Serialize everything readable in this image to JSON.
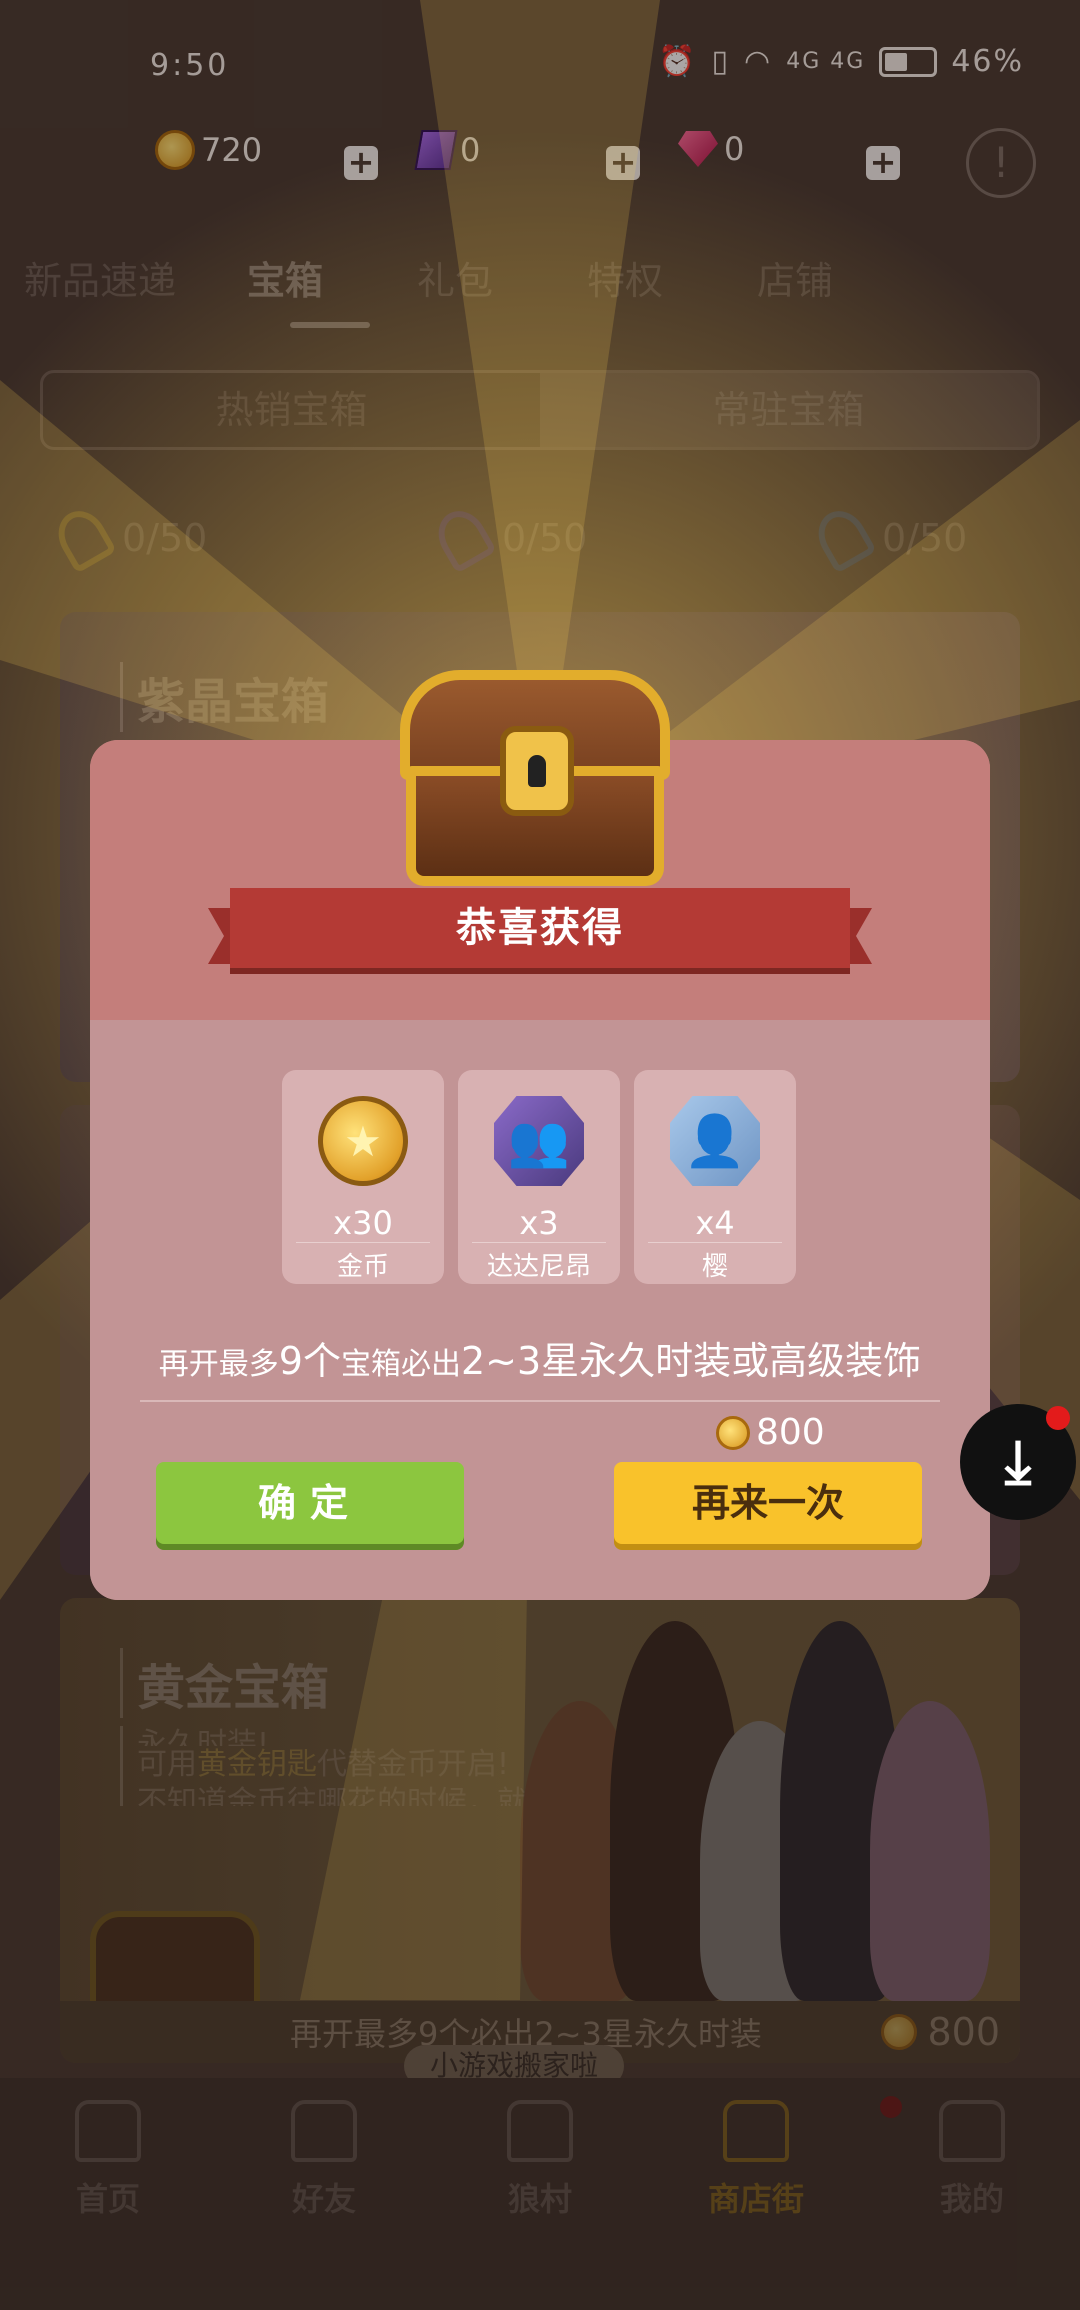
{
  "status_bar": {
    "time": "9:50",
    "network": "4G 4G",
    "battery": "46%"
  },
  "currency": {
    "coins": "720",
    "purple_tickets": "0",
    "gems": "0",
    "plus": "+"
  },
  "alert": "!",
  "top_tabs": [
    "新品速递",
    "宝箱",
    "礼包",
    "特权",
    "店铺"
  ],
  "sub_tabs": [
    "热销宝箱",
    "常驻宝箱"
  ],
  "keys": [
    "0/50",
    "0/50",
    "0/50"
  ],
  "cards": {
    "purple": {
      "title": "紫晶宝箱"
    },
    "gold": {
      "title": "黄金宝箱",
      "desc_line1": "永久时装!",
      "desc_line2_pre": "可用",
      "desc_line2_hl": "黄金钥匙",
      "desc_line2_post": "代替金币开启!",
      "desc_line3": "不知道金币往哪花的时候，就",
      "footer": "再开最多9个必出2~3星永久时装",
      "price": "800"
    }
  },
  "tooltip": "小游戏搬家啦",
  "bottom_nav": [
    "首页",
    "好友",
    "狼村",
    "商店街",
    "我的"
  ],
  "modal": {
    "title": "恭喜获得",
    "rewards": [
      {
        "qty": "x30",
        "name": "金币",
        "icon": "coin-icon"
      },
      {
        "qty": "x3",
        "name": "达达尼昂",
        "icon": "character-avatar-icon"
      },
      {
        "qty": "x4",
        "name": "樱",
        "icon": "character-avatar-icon"
      }
    ],
    "hint_a": "再开最多",
    "hint_b": "9个",
    "hint_c": "宝箱必出",
    "hint_d": "2~3星永久时装或高级装饰",
    "cost": "800",
    "confirm": "确定",
    "again": "再来一次"
  },
  "colors": {
    "confirm": "#8cc63f",
    "again": "#f9c22b",
    "ribbon": "#b43a35",
    "modal": "#c29495"
  }
}
